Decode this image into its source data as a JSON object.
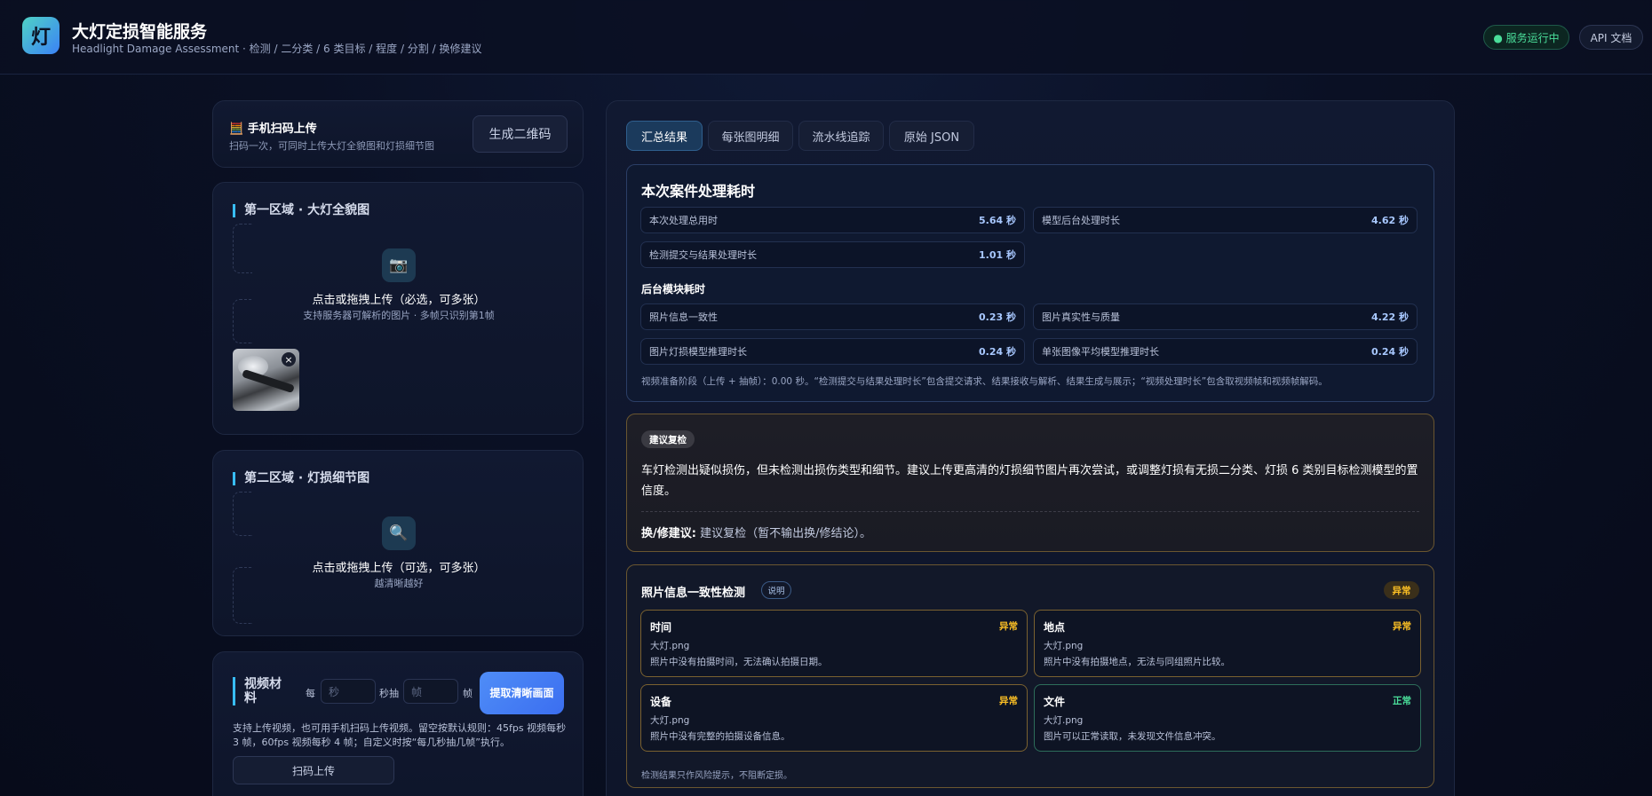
{
  "app": {
    "logo_char": "灯",
    "title": "大灯定损智能服务",
    "subtitle": "Headlight Damage Assessment · 检测 / 二分类 / 6 类目标 / 程度 / 分割 / 换修建议",
    "status_label": "● 服务运行中",
    "api_label": "API 文档"
  },
  "scan_upload": {
    "icon": "phone-qr-icon",
    "icon_char": "🧮",
    "title": "手机扫码上传",
    "desc": "扫码一次，可同时上传大灯全貌图和灯损细节图",
    "button": "生成二维码"
  },
  "zone1": {
    "title": "第一区域 · 大灯全貌图",
    "icon": "camera-icon",
    "icon_char": "📷",
    "main": "点击或拖拽上传（必选，可多张）",
    "sub": "支持服务器可解析的图片 · 多帧只识别第1帧",
    "remove_char": "×"
  },
  "zone2": {
    "title": "第二区域 · 灯损细节图",
    "icon": "magnifier-icon",
    "icon_char": "🔍",
    "main": "点击或拖拽上传（可选，可多张）",
    "sub": "越清晰越好"
  },
  "video": {
    "title": "视频材料",
    "every_label": "每",
    "sec_placeholder": "秒",
    "sec_suffix": "秒抽",
    "frame_placeholder": "帧",
    "frame_suffix": "帧",
    "extract_button": "提取清晰画面",
    "desc": "支持上传视频，也可用手机扫码上传视频。留空按默认规则：45fps 视频每秒 3 帧，60fps 视频每秒 4 帧；自定义时按“每几秒抽几帧”执行。",
    "scan_button": "扫码上传"
  },
  "tabs": [
    {
      "label": "汇总结果",
      "active": true
    },
    {
      "label": "每张图明细",
      "active": false
    },
    {
      "label": "流水线追踪",
      "active": false
    },
    {
      "label": "原始 JSON",
      "active": false
    }
  ],
  "timing": {
    "title": "本次案件处理耗时",
    "metrics": [
      {
        "label": "本次处理总用时",
        "value": "5.64 秒"
      },
      {
        "label": "模型后台处理时长",
        "value": "4.62 秒"
      },
      {
        "label": "检测提交与结果处理时长",
        "value": "1.01 秒"
      }
    ],
    "modules_title": "后台模块耗时",
    "modules": [
      {
        "label": "照片信息一致性",
        "value": "0.23 秒"
      },
      {
        "label": "图片真实性与质量",
        "value": "4.22 秒"
      },
      {
        "label": "图片灯损模型推理时长",
        "value": "0.24 秒"
      },
      {
        "label": "单张图像平均模型推理时长",
        "value": "0.24 秒"
      }
    ],
    "note": "视频准备阶段（上传 + 抽帧）：0.00 秒。“检测提交与结果处理时长”包含提交请求、结果接收与解析、结果生成与展示；“视频处理时长”包含取视频帧和视频帧解码。"
  },
  "advice": {
    "badge": "建议复检",
    "text": "车灯检测出疑似损伤，但未检测出损伤类型和细节。建议上传更高清的灯损细节图片再次尝试，或调整灯损有无损二分类、灯损 6 类别目标检测模型的置信度。",
    "fix_label": "换/修建议:",
    "fix_value": " 建议复检（暂不输出换/修结论）。"
  },
  "consistency": {
    "title": "照片信息一致性检测",
    "help": "说明",
    "status": "异常",
    "cells": [
      {
        "title": "时间",
        "status": "异常",
        "file": "大灯.png",
        "msg": "照片中没有拍摄时间，无法确认拍摄日期。"
      },
      {
        "title": "地点",
        "status": "异常",
        "file": "大灯.png",
        "msg": "照片中没有拍摄地点，无法与同组照片比较。"
      },
      {
        "title": "设备",
        "status": "异常",
        "file": "大灯.png",
        "msg": "照片中没有完整的拍摄设备信息。"
      },
      {
        "title": "文件",
        "status": "正常",
        "file": "大灯.png",
        "msg": "图片可以正常读取，未发现文件信息冲突。"
      }
    ],
    "note": "检测结果只作风险提示，不阻断定损。"
  },
  "colors": {
    "accent": "#38bdf8",
    "primary_button": "#3b6ef0",
    "warning": "#fbbf24",
    "ok": "#4ade9a"
  }
}
